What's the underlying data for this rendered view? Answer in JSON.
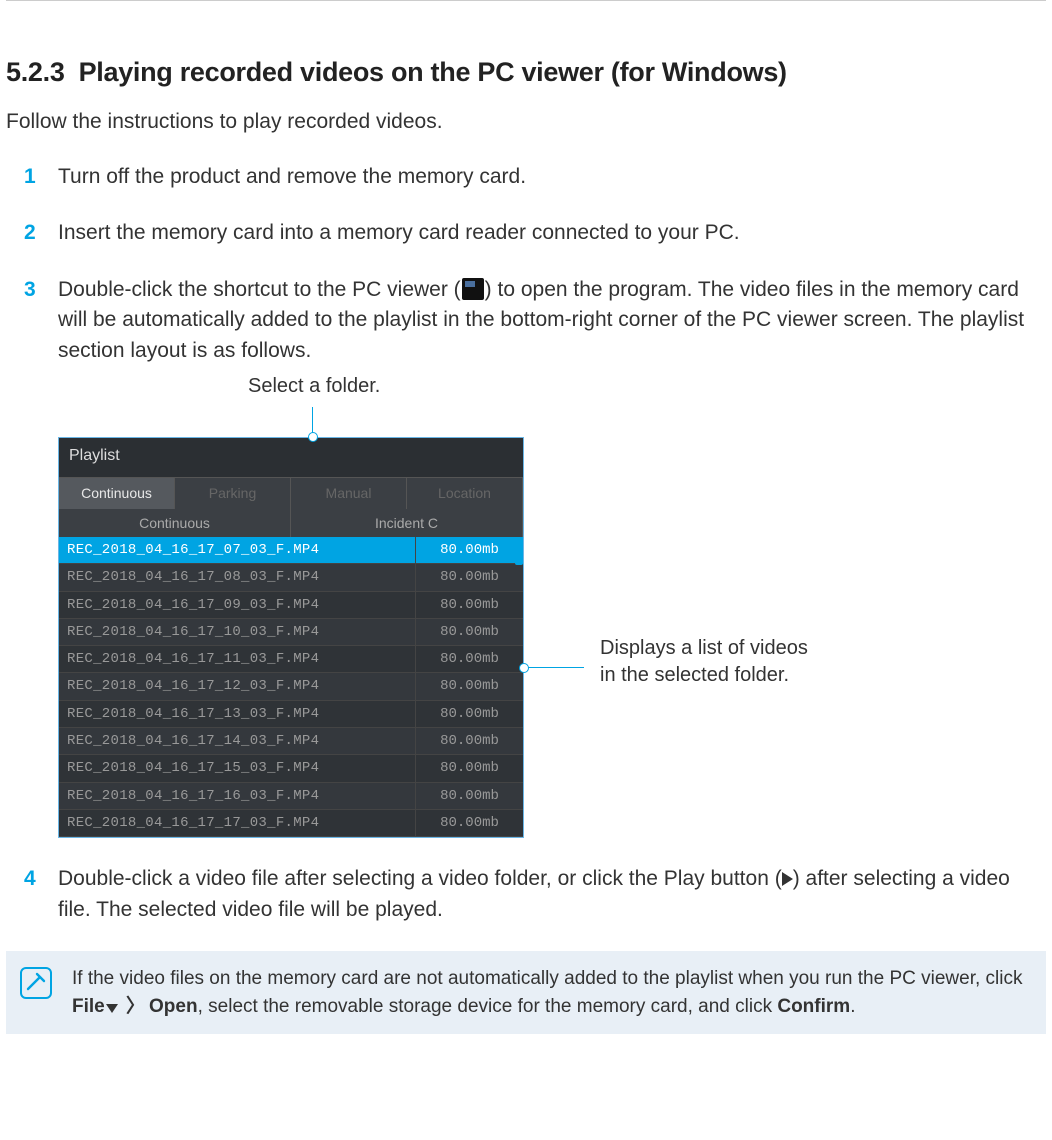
{
  "section": {
    "number": "5.2.3",
    "title": "Playing recorded videos on the PC viewer (for Windows)"
  },
  "intro": "Follow the instructions to play recorded videos.",
  "steps": {
    "s1": {
      "num": "1",
      "text": "Turn off the product and remove the memory card."
    },
    "s2": {
      "num": "2",
      "text": "Insert the memory card into a memory card reader connected to your PC."
    },
    "s3": {
      "num": "3",
      "pre": "Double-click the shortcut to the PC viewer (",
      "post": ") to open the program. The video files in the memory card will be automatically added to the playlist in the bottom-right corner of the PC viewer screen. The playlist section layout is as follows."
    },
    "s4": {
      "num": "4",
      "pre": "Double-click a video file after selecting a video folder, or click the Play button (",
      "post": ") after selecting a video file. The selected video file will be played."
    }
  },
  "callouts": {
    "top": "Select a folder.",
    "side1": "Displays a list of videos",
    "side2": "in the selected folder."
  },
  "playlist": {
    "title": "Playlist",
    "tabs": {
      "t1": "Continuous",
      "t2": "Parking",
      "t3": "Manual",
      "t4": "Location"
    },
    "subtabs": {
      "st1": "Continuous",
      "st2": "Incident C"
    },
    "files": [
      {
        "name": "REC_2018_04_16_17_07_03_F.MP4",
        "size": "80.00mb",
        "selected": true
      },
      {
        "name": "REC_2018_04_16_17_08_03_F.MP4",
        "size": "80.00mb"
      },
      {
        "name": "REC_2018_04_16_17_09_03_F.MP4",
        "size": "80.00mb"
      },
      {
        "name": "REC_2018_04_16_17_10_03_F.MP4",
        "size": "80.00mb"
      },
      {
        "name": "REC_2018_04_16_17_11_03_F.MP4",
        "size": "80.00mb"
      },
      {
        "name": "REC_2018_04_16_17_12_03_F.MP4",
        "size": "80.00mb"
      },
      {
        "name": "REC_2018_04_16_17_13_03_F.MP4",
        "size": "80.00mb"
      },
      {
        "name": "REC_2018_04_16_17_14_03_F.MP4",
        "size": "80.00mb"
      },
      {
        "name": "REC_2018_04_16_17_15_03_F.MP4",
        "size": "80.00mb"
      },
      {
        "name": "REC_2018_04_16_17_16_03_F.MP4",
        "size": "80.00mb"
      },
      {
        "name": "REC_2018_04_16_17_17_03_F.MP4",
        "size": "80.00mb"
      }
    ]
  },
  "note": {
    "pre": "If the video files on the memory card are not automatically added to the playlist when you run the PC viewer, click ",
    "file": "File",
    "open": "Open",
    "mid": ", select the removable storage device for the memory card, and click ",
    "confirm": "Confirm",
    "end": "."
  }
}
